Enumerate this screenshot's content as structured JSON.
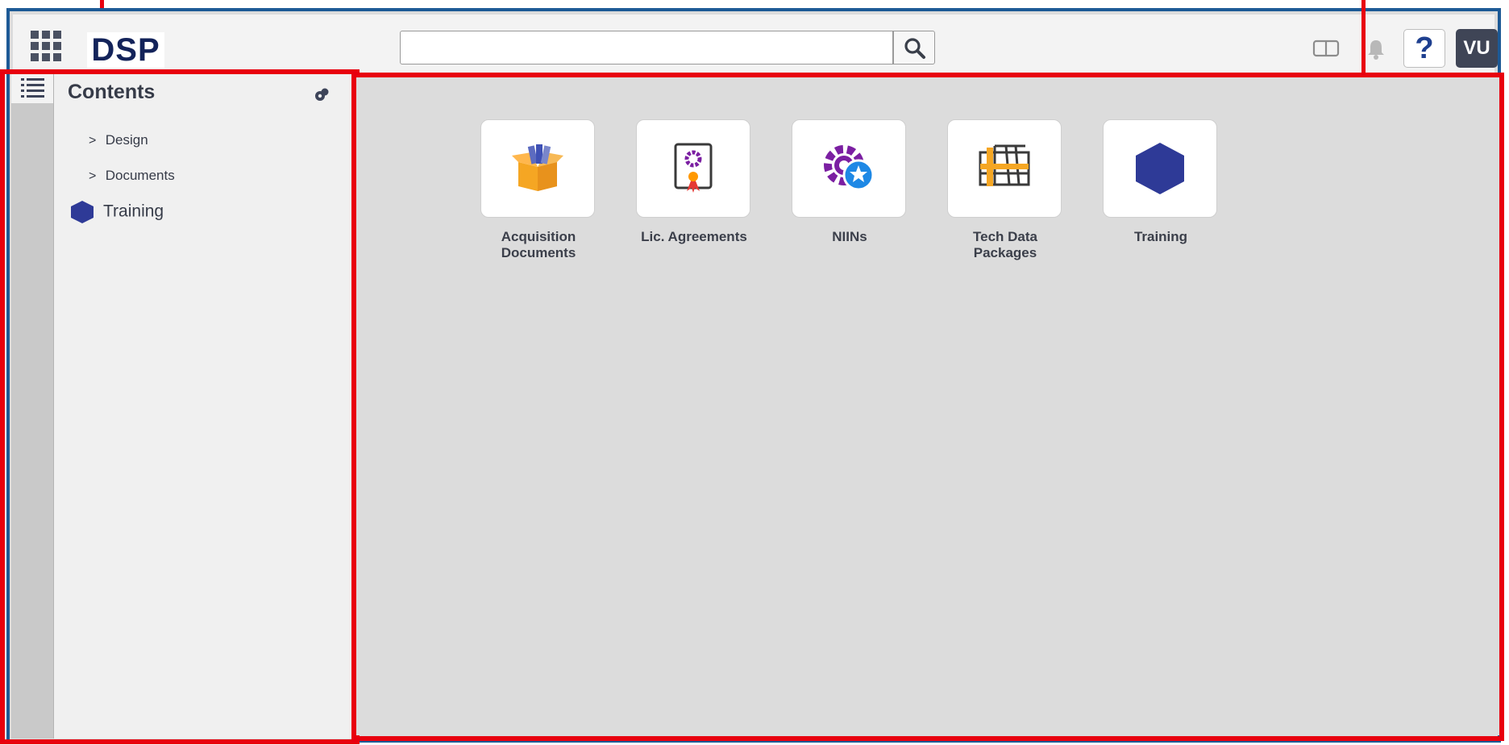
{
  "header": {
    "logo_text": "DSP",
    "search": {
      "value": "",
      "placeholder": ""
    },
    "user_initials": "VU",
    "help_label": "?"
  },
  "sidebar": {
    "title": "Contents",
    "items": [
      {
        "label": "Design",
        "expander": ">"
      },
      {
        "label": "Documents",
        "expander": ">"
      },
      {
        "label": "Training",
        "icon": "hexagon-icon"
      }
    ]
  },
  "main": {
    "tiles": [
      {
        "label": "Acquisition Documents",
        "icon": "open-box-icon"
      },
      {
        "label": "Lic. Agreements",
        "icon": "certificate-icon"
      },
      {
        "label": "NIINs",
        "icon": "gear-star-icon"
      },
      {
        "label": "Tech Data Packages",
        "icon": "grid-table-icon"
      },
      {
        "label": "Training",
        "icon": "hexagon-icon"
      }
    ]
  },
  "colors": {
    "frame_border": "#1d5a96",
    "highlight": "#e8000e",
    "brand_navy": "#13235a",
    "hexagon": "#2e3a97",
    "box_orange": "#f5a623",
    "gear_purple": "#7b1fa2",
    "star_blue": "#1e88e5"
  }
}
